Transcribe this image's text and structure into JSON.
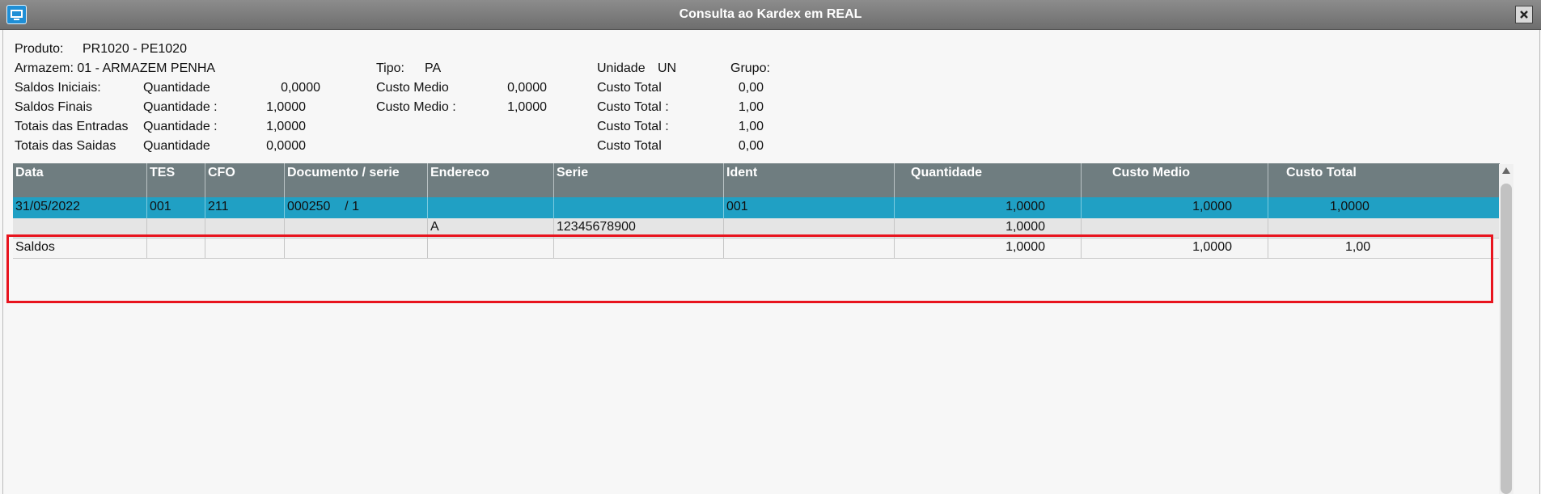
{
  "window": {
    "title": "Consulta ao Kardex em REAL"
  },
  "header": {
    "produto_label": "Produto:",
    "produto_value": "PR1020 - PE1020",
    "armazem": "Armazem: 01 - ARMAZEM PENHA",
    "tipo_label": "Tipo:",
    "tipo_value": "PA",
    "unidade_label": "Unidade",
    "unidade_value": "UN",
    "grupo_label": "Grupo:",
    "saldos_iniciais": {
      "label": "Saldos Iniciais:",
      "qtd_label": "Quantidade",
      "qtd": "0,0000",
      "cm_label": "Custo Medio",
      "cm": "0,0000",
      "ct_label": "Custo Total",
      "ct": "0,00"
    },
    "saldos_finais": {
      "label": "Saldos Finais",
      "qtd_label": "Quantidade :",
      "qtd": "1,0000",
      "cm_label": "Custo Medio :",
      "cm": "1,0000",
      "ct_label": "Custo Total :",
      "ct": "1,00"
    },
    "totais_entradas": {
      "label": "Totais das Entradas",
      "qtd_label": "Quantidade :",
      "qtd": "1,0000",
      "ct_label": "Custo Total :",
      "ct": "1,00"
    },
    "totais_saidas": {
      "label": "Totais das Saidas",
      "qtd_label": "Quantidade",
      "qtd": "0,0000",
      "ct_label": "Custo Total",
      "ct": "0,00"
    }
  },
  "grid": {
    "columns": [
      "Data",
      "TES",
      "CFO",
      "Documento / serie",
      "Endereco",
      "Serie",
      "Ident",
      "Quantidade",
      "Custo Medio",
      "Custo Total"
    ],
    "rows": [
      [
        "31/05/2022",
        "001",
        "211",
        "000250    / 1",
        "",
        "",
        "001",
        "1,0000",
        "1,0000",
        "1,0000"
      ],
      [
        "",
        "",
        "",
        "",
        "A",
        "12345678900",
        "",
        "1,0000",
        "",
        ""
      ],
      [
        "Saldos",
        "",
        "",
        "",
        "",
        "",
        "",
        "1,0000",
        "1,0000",
        "1,00"
      ]
    ]
  },
  "colors": {
    "highlight": "#e8141e",
    "selected_row": "#20a0c4",
    "grid_header": "#6f7d80"
  },
  "icons": {
    "app": "monitor-icon",
    "close": "close-icon",
    "scroll_up": "arrow-up-icon"
  }
}
